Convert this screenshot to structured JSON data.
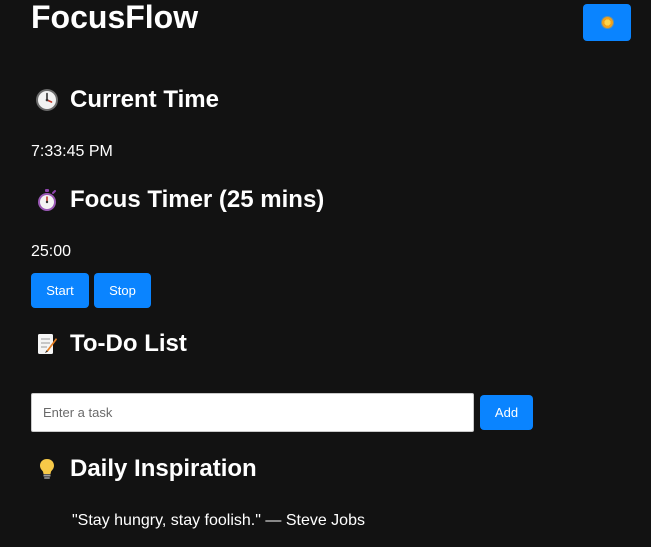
{
  "header": {
    "app_title": "FocusFlow",
    "theme_toggle_icon": "sun-icon"
  },
  "current_time": {
    "icon": "clock-icon",
    "title": "Current Time",
    "value": "7:33:45 PM"
  },
  "focus_timer": {
    "icon": "stopwatch-icon",
    "title": "Focus Timer (25 mins)",
    "value": "25:00",
    "start_label": "Start",
    "stop_label": "Stop"
  },
  "todo": {
    "icon": "memo-icon",
    "title": "To-Do List",
    "input_placeholder": "Enter a task",
    "input_value": "",
    "add_label": "Add"
  },
  "inspiration": {
    "icon": "lightbulb-icon",
    "title": "Daily Inspiration",
    "quote": "\"Stay hungry, stay foolish.\" — Steve Jobs"
  },
  "colors": {
    "background": "#121212",
    "accent": "#0a84ff",
    "text": "#ffffff"
  }
}
